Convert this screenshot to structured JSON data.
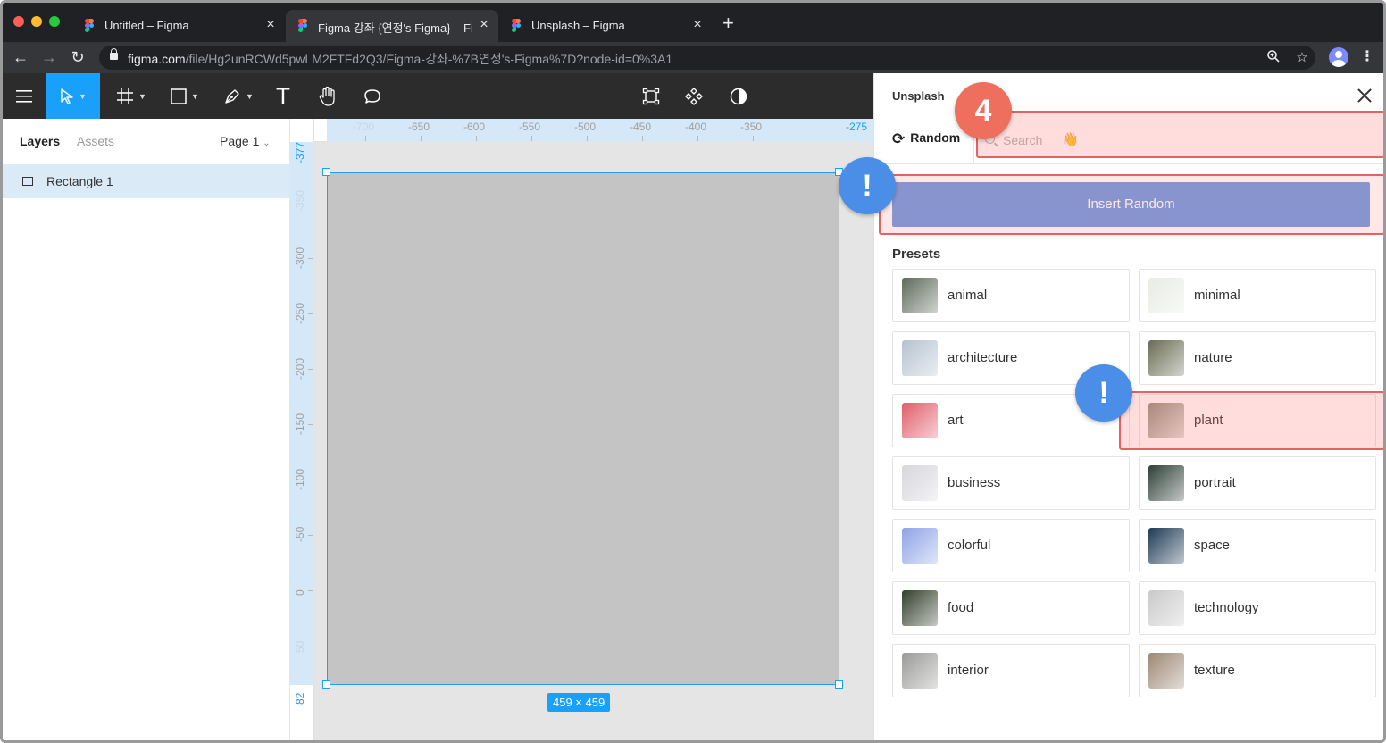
{
  "browser": {
    "tabs": [
      {
        "title": "Untitled – Figma",
        "active": false
      },
      {
        "title": "Figma 강좌 {연정's Figma} – Figma",
        "active": true
      },
      {
        "title": "Unsplash – Figma",
        "active": false
      }
    ],
    "new_tab": "+",
    "url_host": "figma.com",
    "url_path": "/file/Hg2unRCWd5pwLM2FTFd2Q3/Figma-강좌-%7B연정's-Figma%7D?node-id=0%3A1"
  },
  "toolbar": {
    "tools": [
      {
        "name": "menu",
        "icon": "hamburger-icon"
      },
      {
        "name": "move",
        "icon": "pointer-icon",
        "active": true
      },
      {
        "name": "frame",
        "icon": "frame-icon"
      },
      {
        "name": "shape",
        "icon": "rectangle-icon"
      },
      {
        "name": "pen",
        "icon": "pen-icon"
      },
      {
        "name": "text",
        "icon": "text-icon",
        "label": "T"
      },
      {
        "name": "hand",
        "icon": "hand-icon"
      },
      {
        "name": "comment",
        "icon": "comment-icon"
      },
      {
        "name": "create-component",
        "icon": "component-frame-icon"
      },
      {
        "name": "components",
        "icon": "components-icon"
      },
      {
        "name": "mask",
        "icon": "mask-icon"
      }
    ],
    "accent_color": "#18a0fb"
  },
  "layers_panel": {
    "tab_layers": "Layers",
    "tab_assets": "Assets",
    "page": "Page 1",
    "items": [
      {
        "label": "Rectangle 1",
        "icon": "rectangle-icon",
        "selected": true
      }
    ]
  },
  "canvas": {
    "ruler_top": [
      "-700",
      "-650",
      "-600",
      "-550",
      "-500",
      "-450",
      "-400",
      "-350",
      "-275"
    ],
    "ruler_left": [
      "-377",
      "-350",
      "-300",
      "-250",
      "-200",
      "-150",
      "-100",
      "-50",
      "0",
      "50",
      "82"
    ],
    "selection_size": "459 × 459",
    "rect_fill": "#c4c4c4"
  },
  "plugin": {
    "title": "Unsplash",
    "tab_random": "Random",
    "search_placeholder": "Search",
    "search_emoji": "👋",
    "insert_random": "Insert Random",
    "presets_title": "Presets",
    "presets": [
      {
        "label": "animal",
        "thumb": "#5d6a5a"
      },
      {
        "label": "minimal",
        "thumb": "#e8ece4"
      },
      {
        "label": "architecture",
        "thumb": "#b5c2d1"
      },
      {
        "label": "nature",
        "thumb": "#6a6d54"
      },
      {
        "label": "art",
        "thumb": "#e15d6a"
      },
      {
        "label": "plant",
        "thumb": "#8c8f7a"
      },
      {
        "label": "business",
        "thumb": "#d6d6dc"
      },
      {
        "label": "portrait",
        "thumb": "#2e4038"
      },
      {
        "label": "colorful",
        "thumb": "#8ea3e6"
      },
      {
        "label": "space",
        "thumb": "#1d3a55"
      },
      {
        "label": "food",
        "thumb": "#33402c"
      },
      {
        "label": "technology",
        "thumb": "#c9c9c9"
      },
      {
        "label": "interior",
        "thumb": "#9a9a98"
      },
      {
        "label": "texture",
        "thumb": "#9c8873"
      }
    ]
  },
  "annotations": {
    "step_number": "4",
    "alert": "!"
  }
}
